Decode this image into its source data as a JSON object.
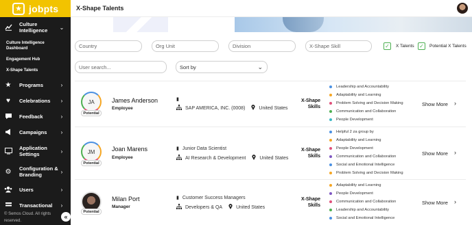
{
  "brand": {
    "name": "jobpts",
    "logo_icon": "star-icon",
    "color": "#f2c300"
  },
  "sidebar": {
    "items": [
      {
        "label": "Culture Intelligence",
        "icon": "chart-icon",
        "expanded": true
      },
      {
        "label": "Programs",
        "icon": "star-icon"
      },
      {
        "label": "Celebrations",
        "icon": "heart-icon"
      },
      {
        "label": "Feedback",
        "icon": "chat-icon"
      },
      {
        "label": "Campaigns",
        "icon": "megaphone-icon"
      },
      {
        "label": "Application Settings",
        "icon": "monitor-icon"
      },
      {
        "label": "Configuration & Branding",
        "icon": "gear-icon"
      },
      {
        "label": "Users",
        "icon": "users-icon"
      },
      {
        "label": "Transactional",
        "icon": "stack-icon"
      }
    ],
    "sub_items": [
      {
        "label": "Culture Intelligence Dashboard"
      },
      {
        "label": "Engagement Hub"
      },
      {
        "label": "X-Shape Talents"
      }
    ],
    "footer": "© Semos Cloud. All rights reserved.",
    "collapse_icon": "double-chevron-left-icon"
  },
  "header": {
    "title": "X-Shape Talents"
  },
  "filters": {
    "country": "Country",
    "org_unit": "Org Unit",
    "division": "Division",
    "skill": "X-Shape Skill",
    "x_talents_label": "X Talents",
    "potential_label": "Potential X Talents",
    "x_talents_checked": true,
    "potential_checked": true,
    "search_placeholder": "User search...",
    "sort_label": "Sort by"
  },
  "people": [
    {
      "initials": "JA",
      "name": "James Anderson",
      "role": "Employee",
      "badge": "Potential",
      "title": "",
      "org": "SAP AMERICA, INC. (0008)",
      "location": "United States",
      "xshape_label": "X-Shape Skills",
      "skills": [
        {
          "label": "Leadership and Accountability",
          "color": "#4a90e2"
        },
        {
          "label": "Adaptability and Learning",
          "color": "#f5a623"
        },
        {
          "label": "Problem Solving and Decision Making",
          "color": "#e0507a"
        },
        {
          "label": "Communication and Collaboration",
          "color": "#4caf50"
        },
        {
          "label": "People Development",
          "color": "#3bb8c4"
        }
      ],
      "show_more": "Show More"
    },
    {
      "initials": "JM",
      "name": "Joan Marens",
      "role": "Employee",
      "badge": "Potential",
      "title": "Junior Data Scientist",
      "org": "AI Research & Development",
      "location": "United States",
      "xshape_label": "X-Shape Skills",
      "skills": [
        {
          "label": "Helpful 2 za group by",
          "color": "#4a90e2"
        },
        {
          "label": "Adaptability and Learning",
          "color": "#f5a623"
        },
        {
          "label": "People Development",
          "color": "#e0507a"
        },
        {
          "label": "Communication and Collaboration",
          "color": "#7e57c2"
        },
        {
          "label": "Social and Emotional Intelligence",
          "color": "#4a90e2"
        },
        {
          "label": "Problem Solving and Decision Making",
          "color": "#f5a623"
        }
      ],
      "show_more": "Show More"
    },
    {
      "initials": "",
      "name": "Milan Port",
      "role": "Manager",
      "badge": "Potential",
      "title": "Customer Success Managers",
      "org": "Developers & QA",
      "location": "United States",
      "xshape_label": "X-Shape Skills",
      "skills": [
        {
          "label": "Adaptability and Learning",
          "color": "#f5a623"
        },
        {
          "label": "People Development",
          "color": "#7e57c2"
        },
        {
          "label": "Communication and Collaboration",
          "color": "#e0507a"
        },
        {
          "label": "Leadership and Accountability",
          "color": "#4caf50"
        },
        {
          "label": "Social and Emotional Intelligence",
          "color": "#4a90e2"
        }
      ],
      "show_more": "Show More"
    }
  ]
}
